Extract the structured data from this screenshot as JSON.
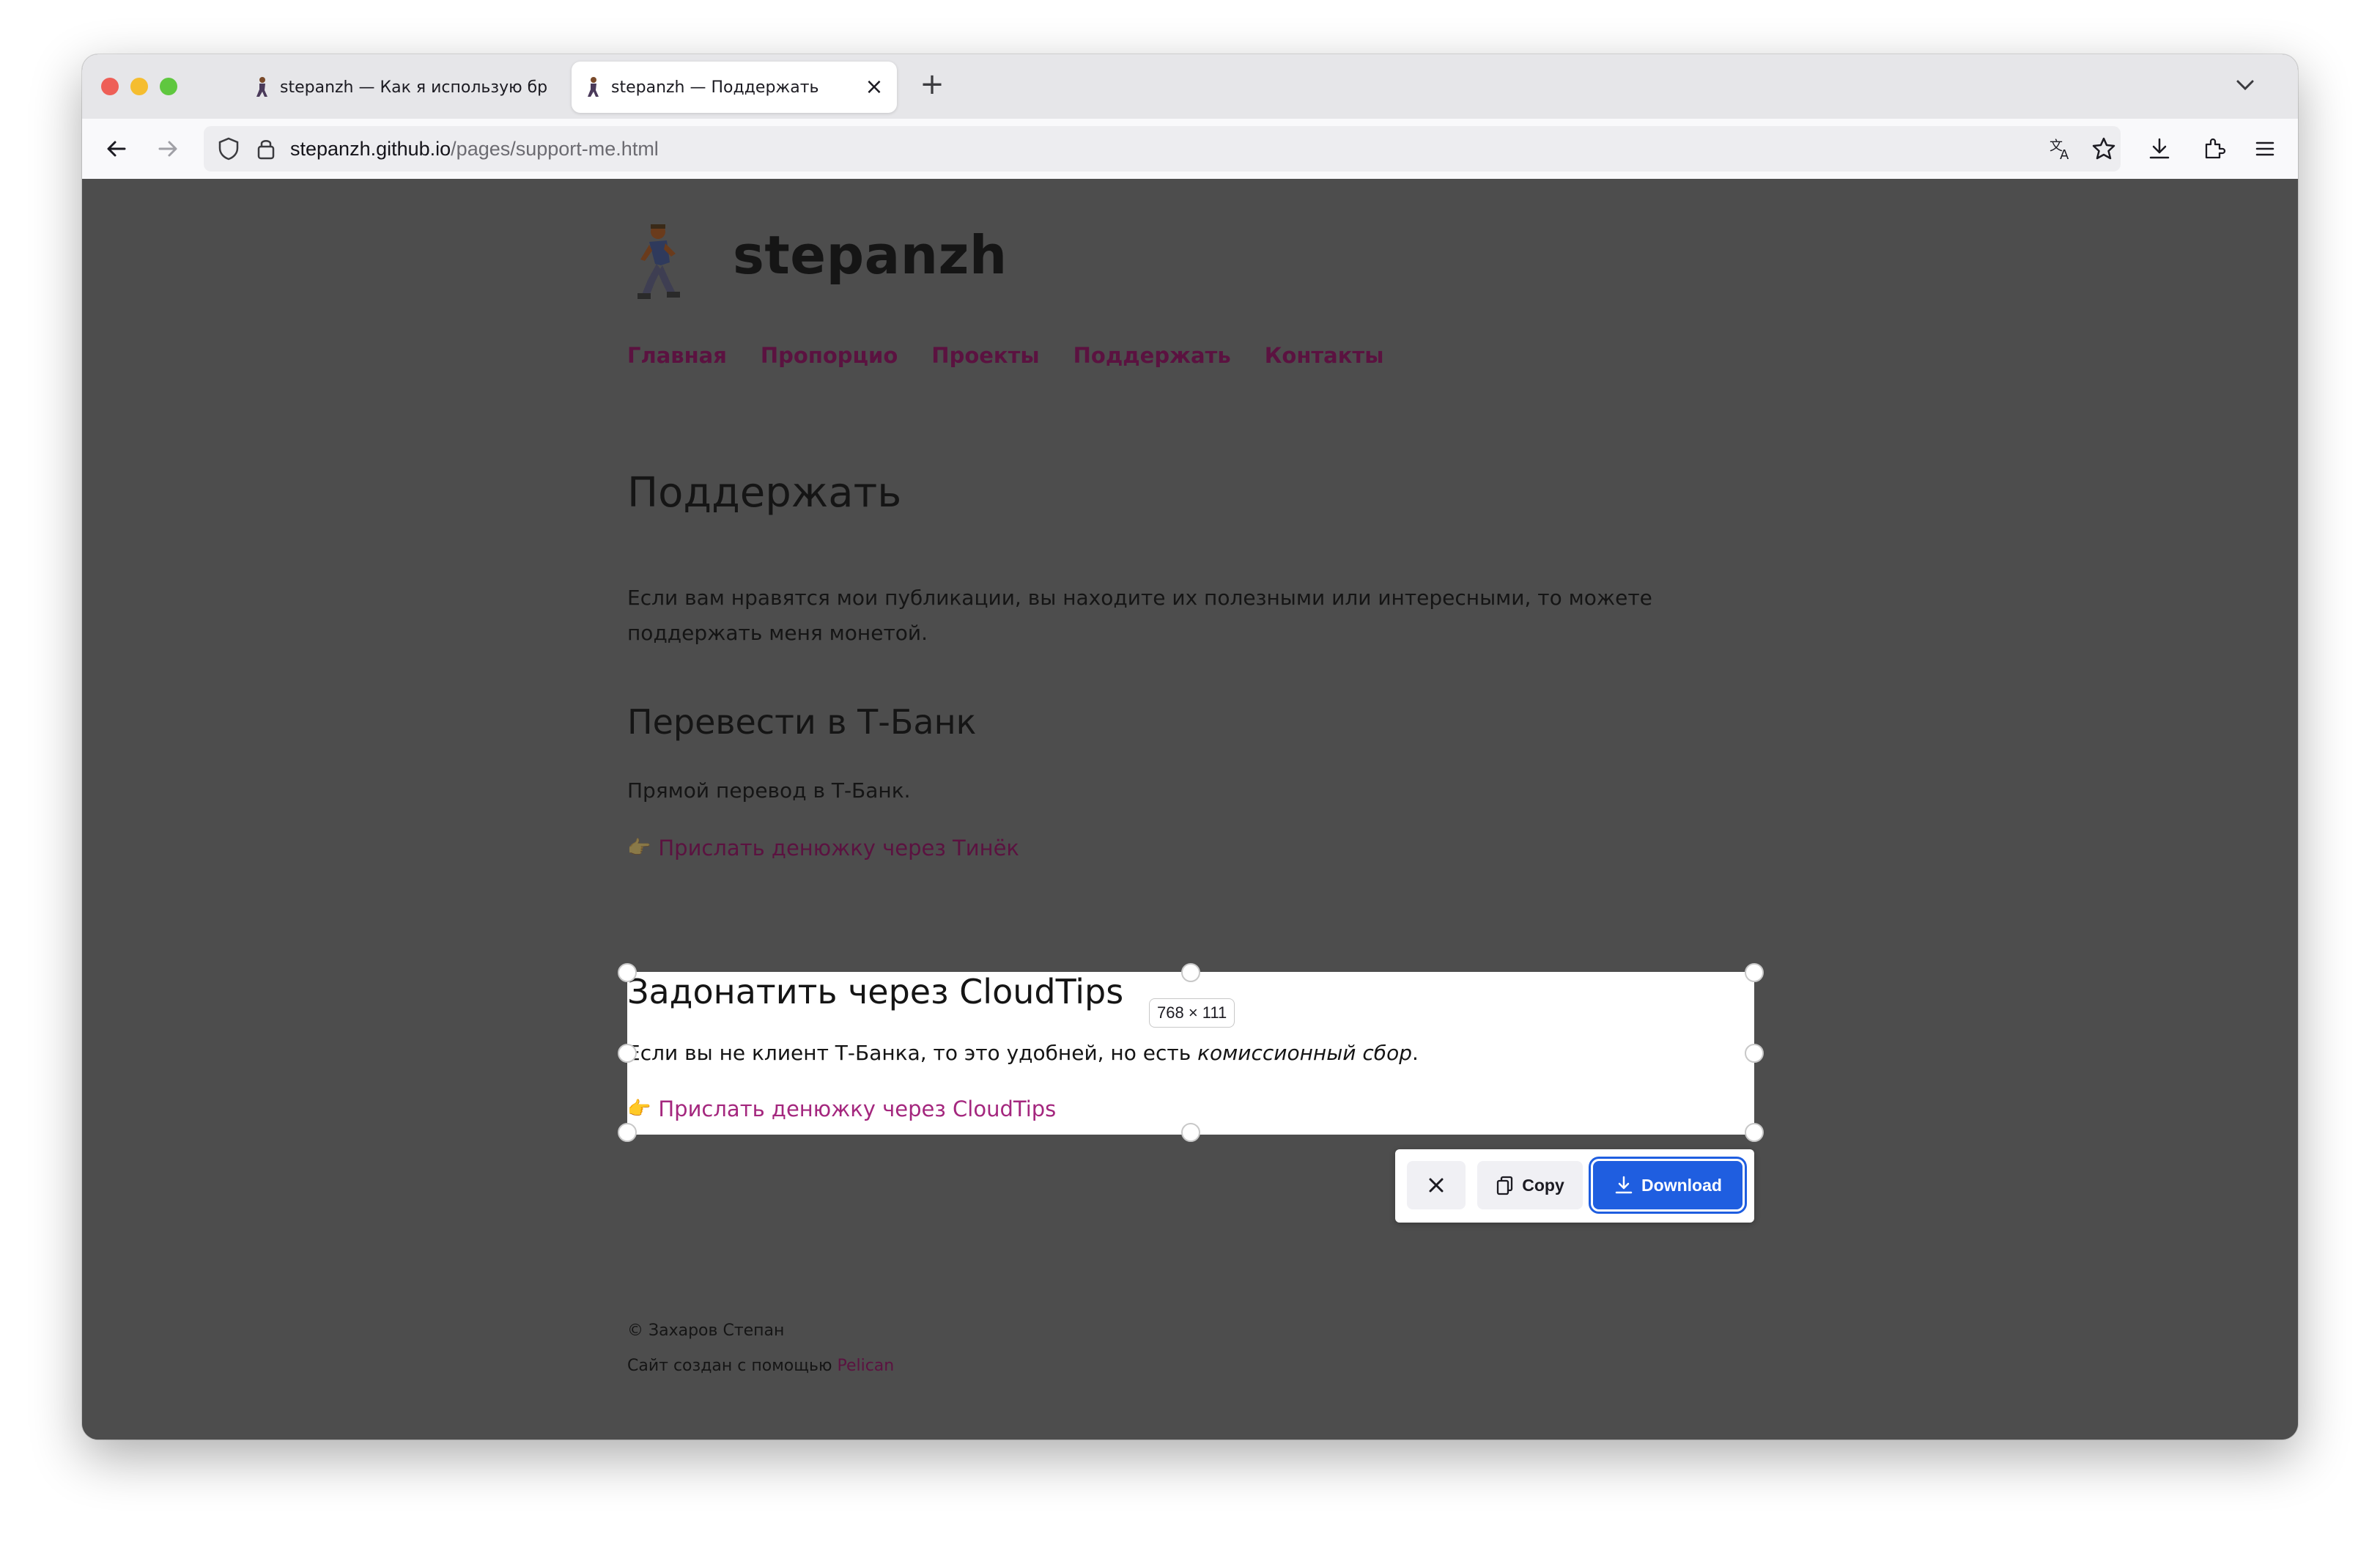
{
  "browser": {
    "tabs": [
      {
        "title": "stepanzh — Как я использую бр",
        "active": false
      },
      {
        "title": "stepanzh — Поддержать",
        "active": true
      }
    ],
    "url_host": "stepanzh.github.io",
    "url_path": "/pages/support-me.html",
    "traffic_lights": [
      "#ee5f57",
      "#f5bd2f",
      "#5fc73f"
    ]
  },
  "site": {
    "title": "stepanzh",
    "menu": [
      "Главная",
      "Пропорцио",
      "Проекты",
      "Поддержать",
      "Контакты"
    ],
    "link_color": "#5b1240"
  },
  "content": {
    "h1": "Поддержать",
    "intro": "Если вам нравятся мои публикации, вы находите их полезными или интересными, то можете поддержать меня монетой.",
    "section1": {
      "heading": "Перевести в Т-Банк",
      "text": "Прямой перевод в Т-Банк.",
      "hand": "👉",
      "link": "Прислать денюжку через Тинёк"
    },
    "section2": {
      "heading": "Задонатить через CloudTips",
      "text_start": "Если вы не клиент Т-Банка, то это удобней, но есть ",
      "text_italic": "комиссионный сбор",
      "text_end": ".",
      "hand": "👉",
      "link": "Прислать денюжку через CloudTips"
    }
  },
  "screenshot_tool": {
    "dimensions_label": "768 × 111",
    "copy_label": "Copy",
    "download_label": "Download",
    "accent": "#1f5ee0"
  },
  "footer": {
    "copyright": "© Захаров Степан",
    "made_with": "Сайт создан с помощью ",
    "made_with_link": "Pelican"
  }
}
